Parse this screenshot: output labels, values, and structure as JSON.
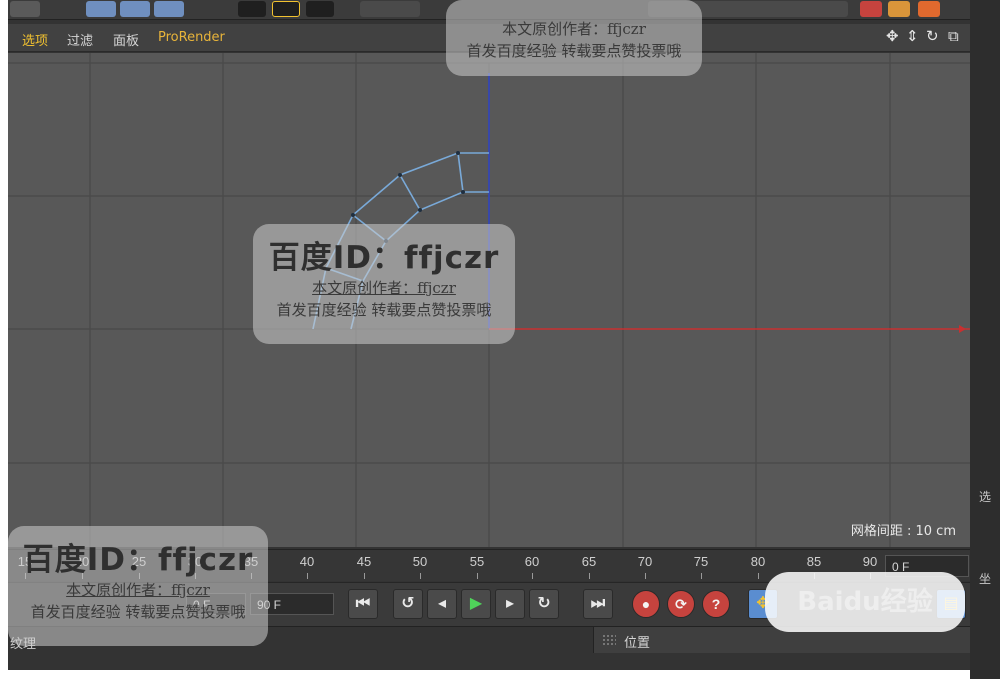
{
  "viewport_menu": {
    "items": [
      "选项",
      "过滤",
      "面板",
      "ProRender"
    ],
    "nav_icons": [
      "move-icon",
      "zoom-icon",
      "rotate-icon",
      "maximize-icon"
    ]
  },
  "viewport": {
    "grid_spacing": "网格间距 : 10 cm"
  },
  "timeline": {
    "ticks": [
      "15",
      "20",
      "25",
      "30",
      "35",
      "40",
      "45",
      "50",
      "55",
      "60",
      "65",
      "70",
      "75",
      "80",
      "85",
      "90"
    ],
    "current_frame": "0 F"
  },
  "transport": {
    "start_field": "0 F",
    "end_field": "90 F",
    "buttons": [
      "go-to-start",
      "previous-keyframe",
      "previous-frame",
      "play",
      "next-frame",
      "next-keyframe",
      "go-to-end",
      "record",
      "auto-key",
      "help"
    ]
  },
  "bottom_panel": {
    "material_label": "纹理",
    "coordinates_label": "位置"
  },
  "right_strip": {
    "chars": [
      "选",
      "坐"
    ]
  },
  "watermarks": {
    "top_line1": "本文原创作者：ffjczr",
    "top_line2": "首发百度经验  转载要点赞投票哦",
    "center_id": "百度ID：ffjczr",
    "center_line1": "本文原创作者：ffjczr",
    "center_line2": "首发百度经验  转载要点赞投票哦",
    "bottom_id": "百度ID：ffjczr",
    "bottom_line1": "本文原创作者：ffjczr",
    "bottom_line2": "首发百度经验  转载要点赞投票哦",
    "logo_text": "Baidu经验"
  },
  "colors": {
    "accent": "#f2c230",
    "viewport_bg": "#585858",
    "spline": "#79a9d8",
    "axis_y": "#3046c8",
    "axis_x": "#c83030"
  }
}
